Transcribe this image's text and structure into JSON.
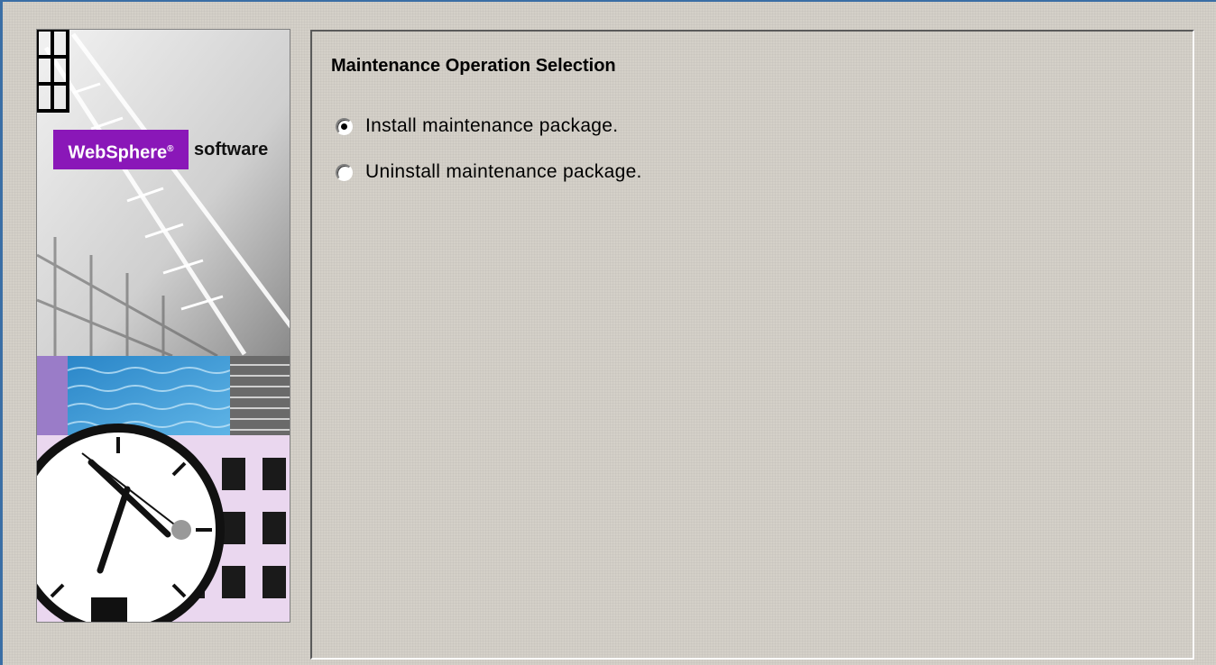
{
  "banner": {
    "brand": "WebSphere",
    "brand_mark": "®",
    "suffix": "software"
  },
  "panel": {
    "title": "Maintenance Operation Selection",
    "options": [
      {
        "label": "Install maintenance package.",
        "selected": true
      },
      {
        "label": "Uninstall maintenance package.",
        "selected": false
      }
    ]
  },
  "colors": {
    "background": "#d4d0c8",
    "brand_purple": "#8a17b8",
    "window_border": "#3a6ea5"
  }
}
